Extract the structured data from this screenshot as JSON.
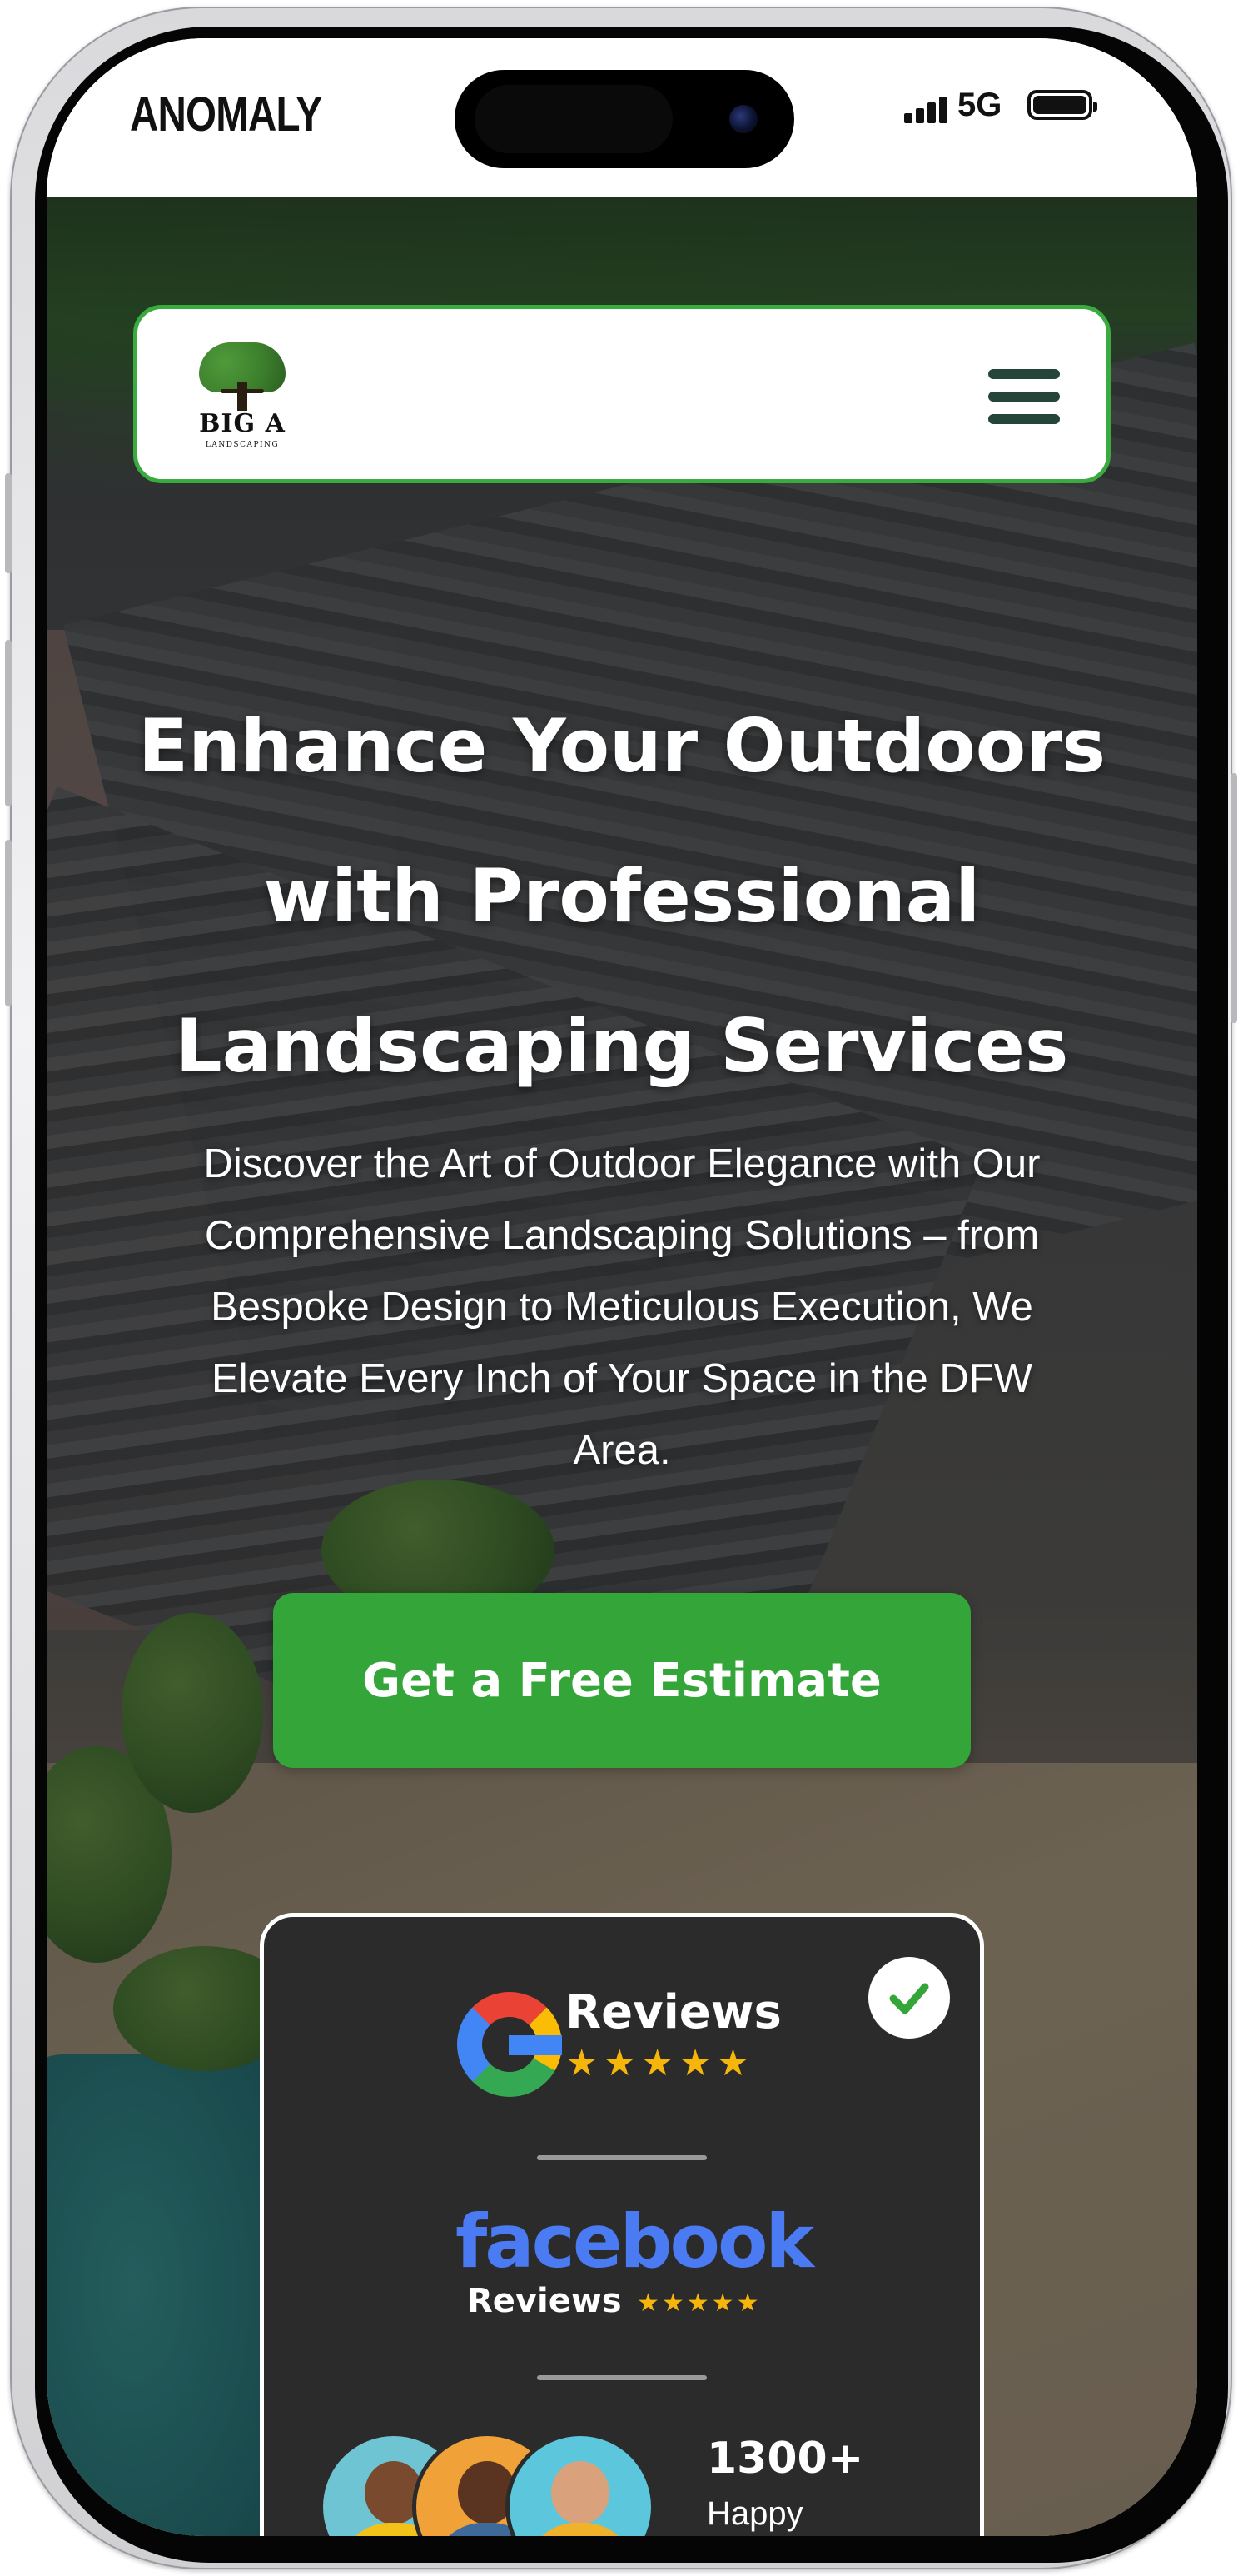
{
  "status_bar": {
    "carrier": "ANOMALY",
    "network": "5G",
    "battery": "full-battery-icon",
    "signal": "cellular-signal-icon"
  },
  "brand": {
    "name": "BIG A",
    "tagline": "LANDSCAPING",
    "accent": "#34a539",
    "menu_icon": "hamburger-menu-icon"
  },
  "hero": {
    "headline_line1": "Enhance Your Outdoors",
    "headline_line2": "with Professional",
    "headline_line3": "Landscaping Services",
    "subtext_line1": "Discover the Art of Outdoor Elegance with Our",
    "subtext_line2": "Comprehensive Landscaping Solutions – from",
    "subtext_line3": "Bespoke Design to Meticulous Execution, We",
    "subtext_line4": "Elevate Every Inch of Your Space in the DFW",
    "subtext_line5": "Area.",
    "cta_label": "Get a Free Estimate"
  },
  "reviews": {
    "google_label": "Reviews",
    "google_stars": "★★★★★",
    "facebook_word": "facebook",
    "facebook_label": "Reviews",
    "facebook_stars": "★★★★★",
    "count": "1300+",
    "count_label": "Happy",
    "verified_icon": "check-icon"
  }
}
